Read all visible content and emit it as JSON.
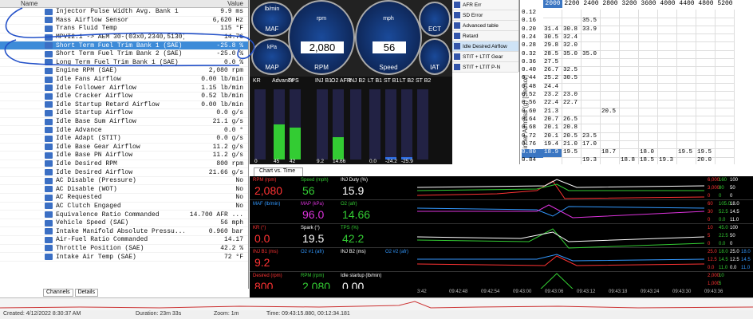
{
  "params": {
    "header_name": "Name",
    "header_value": "Value",
    "rows": [
      {
        "name": "Injector Pulse Width Avg. Bank 1",
        "value": "9.9 ms"
      },
      {
        "name": "Mass Airflow Sensor",
        "value": "6,620 Hz"
      },
      {
        "name": "Trans Fluid Temp",
        "value": "115 °F"
      },
      {
        "name": "MPVI2.1 -> AEM 30-(03x0,2340,5130)",
        "value": "14.76"
      },
      {
        "name": "Short Term Fuel Trim Bank 1 (SAE)",
        "value": "-25.8 %"
      },
      {
        "name": "Short Term Fuel Trim Bank 2 (SAE)",
        "value": "-25.0 %"
      },
      {
        "name": "Long Term Fuel Trim Bank 1 (SAE)",
        "value": "0.0 %"
      },
      {
        "name": "Engine RPM (SAE)",
        "value": "2,080 rpm"
      },
      {
        "name": "Idle Fans Airflow",
        "value": "0.00 lb/min"
      },
      {
        "name": "Idle Follower Airflow",
        "value": "1.15 lb/min"
      },
      {
        "name": "Idle Cracker Airflow",
        "value": "0.52 lb/min"
      },
      {
        "name": "Idle Startup Retard Airflow",
        "value": "0.00 lb/min"
      },
      {
        "name": "Idle Startup Airflow",
        "value": "0.0 g/s"
      },
      {
        "name": "Idle Base Sum Airflow",
        "value": "21.1 g/s"
      },
      {
        "name": "Idle Advance",
        "value": "0.0 °"
      },
      {
        "name": "Idle Adapt (STIT)",
        "value": "0.0 g/s"
      },
      {
        "name": "Idle Base Gear Airflow",
        "value": "11.2 g/s"
      },
      {
        "name": "Idle Base PN Airflow",
        "value": "11.2 g/s"
      },
      {
        "name": "Idle Desired RPM",
        "value": "800 rpm"
      },
      {
        "name": "Idle Desired Airflow",
        "value": "21.66 g/s"
      },
      {
        "name": "AC Disable (Pressure)",
        "value": "No"
      },
      {
        "name": "AC Disable (WOT)",
        "value": "No"
      },
      {
        "name": "AC Requested",
        "value": "No"
      },
      {
        "name": "AC Clutch Engaged",
        "value": "No"
      },
      {
        "name": "Equivalence Ratio Commanded",
        "value": "14.700 AFR ..."
      },
      {
        "name": "Vehicle Speed (SAE)",
        "value": "56 mph"
      },
      {
        "name": "Intake Manifold Absolute Pressu...",
        "value": "0.960 bar"
      },
      {
        "name": "Air-Fuel Ratio Commanded",
        "value": "14.17"
      },
      {
        "name": "Throttle Position (SAE)",
        "value": "42.2 %"
      },
      {
        "name": "Intake Air Temp (SAE)",
        "value": "72 °F"
      }
    ]
  },
  "gauges": {
    "rpm_value": "2,080",
    "rpm_label": "RPM",
    "rpm_unit": "rpm",
    "speed_value": "56",
    "speed_label": "Speed",
    "speed_unit": "mph",
    "maf": "MAF",
    "map": "MAP",
    "ect": "ECT",
    "iat": "IAT",
    "maf_unit": "lb/min",
    "map_unit": "kPa"
  },
  "bars": {
    "labels": [
      "KR",
      "Advance",
      "TPS",
      "INJ B1",
      "O2 AFR",
      "INJ B2",
      "LT B1",
      "ST B1",
      "LT B2",
      "ST B2"
    ],
    "values": [
      "0",
      "45",
      "42",
      "9.2",
      "14.66",
      "",
      "0.0",
      "-24.2",
      "-25.9",
      ""
    ]
  },
  "menu": [
    "AFR Err",
    "SD Error",
    "Advanced table",
    "Retard",
    "Idle Desired Airflow",
    "STIT + LTIT Gear",
    "STIT + LTIT P-N"
  ],
  "table": {
    "cols": [
      "2000",
      "2200",
      "2400",
      "2800",
      "3200",
      "3600",
      "4000",
      "4400",
      "4800",
      "5200"
    ],
    "yaxis": "Cylinder Airmass (g) [Sensor]",
    "rows": [
      {
        "k": "0.12",
        "v": [
          "",
          "",
          "",
          "",
          "",
          "",
          "",
          "",
          "",
          ""
        ]
      },
      {
        "k": "0.16",
        "v": [
          "",
          "",
          "35.5",
          "",
          "",
          "",
          "",
          "",
          "",
          ""
        ]
      },
      {
        "k": "0.20",
        "v": [
          "31.4",
          "30.8",
          "33.9",
          "",
          "",
          "",
          "",
          "",
          "",
          ""
        ]
      },
      {
        "k": "0.24",
        "v": [
          "30.5",
          "32.4",
          "",
          "",
          "",
          "",
          "",
          "",
          "",
          ""
        ]
      },
      {
        "k": "0.28",
        "v": [
          "29.8",
          "32.0",
          "",
          "",
          "",
          "",
          "",
          "",
          "",
          ""
        ]
      },
      {
        "k": "0.32",
        "v": [
          "28.5",
          "35.0",
          "35.0",
          "",
          "",
          "",
          "",
          "",
          "",
          ""
        ]
      },
      {
        "k": "0.36",
        "v": [
          "27.5",
          "",
          "",
          "",
          "",
          "",
          "",
          "",
          "",
          ""
        ]
      },
      {
        "k": "0.40",
        "v": [
          "26.7",
          "32.5",
          "",
          "",
          "",
          "",
          "",
          "",
          "",
          ""
        ]
      },
      {
        "k": "0.44",
        "v": [
          "25.2",
          "30.5",
          "",
          "",
          "",
          "",
          "",
          "",
          "",
          ""
        ]
      },
      {
        "k": "0.48",
        "v": [
          "24.4",
          "",
          "",
          "",
          "",
          "",
          "",
          "",
          "",
          ""
        ]
      },
      {
        "k": "0.52",
        "v": [
          "23.2",
          "23.0",
          "",
          "",
          "",
          "",
          "",
          "",
          "",
          ""
        ]
      },
      {
        "k": "0.56",
        "v": [
          "22.4",
          "22.7",
          "",
          "",
          "",
          "",
          "",
          "",
          "",
          ""
        ]
      },
      {
        "k": "0.60",
        "v": [
          "21.3",
          "",
          "",
          "20.5",
          "",
          "",
          "",
          "",
          "",
          ""
        ]
      },
      {
        "k": "0.64",
        "v": [
          "20.7",
          "26.5",
          "",
          "",
          "",
          "",
          "",
          "",
          "",
          ""
        ]
      },
      {
        "k": "0.68",
        "v": [
          "20.1",
          "20.8",
          "",
          "",
          "",
          "",
          "",
          "",
          "",
          ""
        ]
      },
      {
        "k": "0.72",
        "v": [
          "20.1",
          "20.5",
          "23.5",
          "",
          "",
          "",
          "",
          "",
          "",
          ""
        ]
      },
      {
        "k": "0.76",
        "v": [
          "19.4",
          "21.0",
          "17.0",
          "",
          "",
          "",
          "",
          "",
          "",
          ""
        ]
      },
      {
        "k": "0.80",
        "v": [
          "18.9",
          "19.5",
          "",
          "18.7",
          "",
          "18.0",
          "",
          "19.5",
          "19.5",
          ""
        ]
      },
      {
        "k": "0.84",
        "v": [
          "",
          "",
          "19.3",
          "",
          "18.8",
          "18.5",
          "19.3",
          "",
          "20.0",
          ""
        ]
      }
    ]
  },
  "chart_tab": "Chart vs. Time",
  "channels": [
    {
      "a": "RPM (rpm)",
      "av": "2,080",
      "b": "Speed (mph)",
      "bv": "56",
      "c": "INJ Duty (%)",
      "cv": "15.9"
    },
    {
      "a": "MAF (lb/min)",
      "av": "",
      "b": "MAP (kPa)",
      "bv": "96.0",
      "c": "O2 (afr)",
      "cv": "14.66"
    },
    {
      "a": "KR (°)",
      "av": "0.0",
      "b": "Spark (°)",
      "bv": "19.5",
      "c": "TPS (%)",
      "cv": "42.2"
    },
    {
      "a": "INJ B1 (ms)",
      "av": "9.2",
      "b": "O2 #1 (afr)",
      "bv": "",
      "c": "INJ B2 (ms)",
      "cv": "",
      "d": "O2 #2 (afr)"
    },
    {
      "a": "Desired (rpm)",
      "av": "800",
      "b": "RPM (rpm)",
      "bv": "2,080",
      "c": "Idle startup (lb/min)",
      "cv": "0.00"
    }
  ],
  "scale": [
    [
      "6,000",
      "160",
      "100"
    ],
    [
      "3,000",
      "80",
      "50"
    ],
    [
      "0",
      "0",
      "0"
    ],
    [
      "60",
      "105.0",
      "18.0"
    ],
    [
      "30",
      "52.5",
      "14.5"
    ],
    [
      "0",
      "0.0",
      "11.0"
    ],
    [
      "10",
      "45.0",
      "100"
    ],
    [
      "5",
      "22.5",
      "50"
    ],
    [
      "0",
      "0.0",
      "0"
    ],
    [
      "25.0",
      "18.0",
      "25.0",
      "18.0"
    ],
    [
      "12.5",
      "14.5",
      "12.5",
      "14.5"
    ],
    [
      "0.0",
      "11.0",
      "0.0",
      "11.0"
    ],
    [
      "2,000",
      "10"
    ],
    [
      "1,000",
      "5"
    ],
    [
      "0",
      "0"
    ]
  ],
  "times": [
    "3:42",
    "09:42:48",
    "09:42:54",
    "09:43:00",
    "09:43:06",
    "09:43:12",
    "09:43:18",
    "09:43:24",
    "09:43:30",
    "09:43:36"
  ],
  "tabs": [
    "Channels",
    "Details"
  ],
  "status": {
    "created": "Created: 4/12/2022 8:30:37 AM",
    "duration": "Duration: 23m 33s",
    "zoom": "Zoom: 1m",
    "time": "Time: 09:43:15.880, 00:12:34.181"
  },
  "colors": {
    "select": "#3d8bd8",
    "accent": "#3b76c2"
  }
}
